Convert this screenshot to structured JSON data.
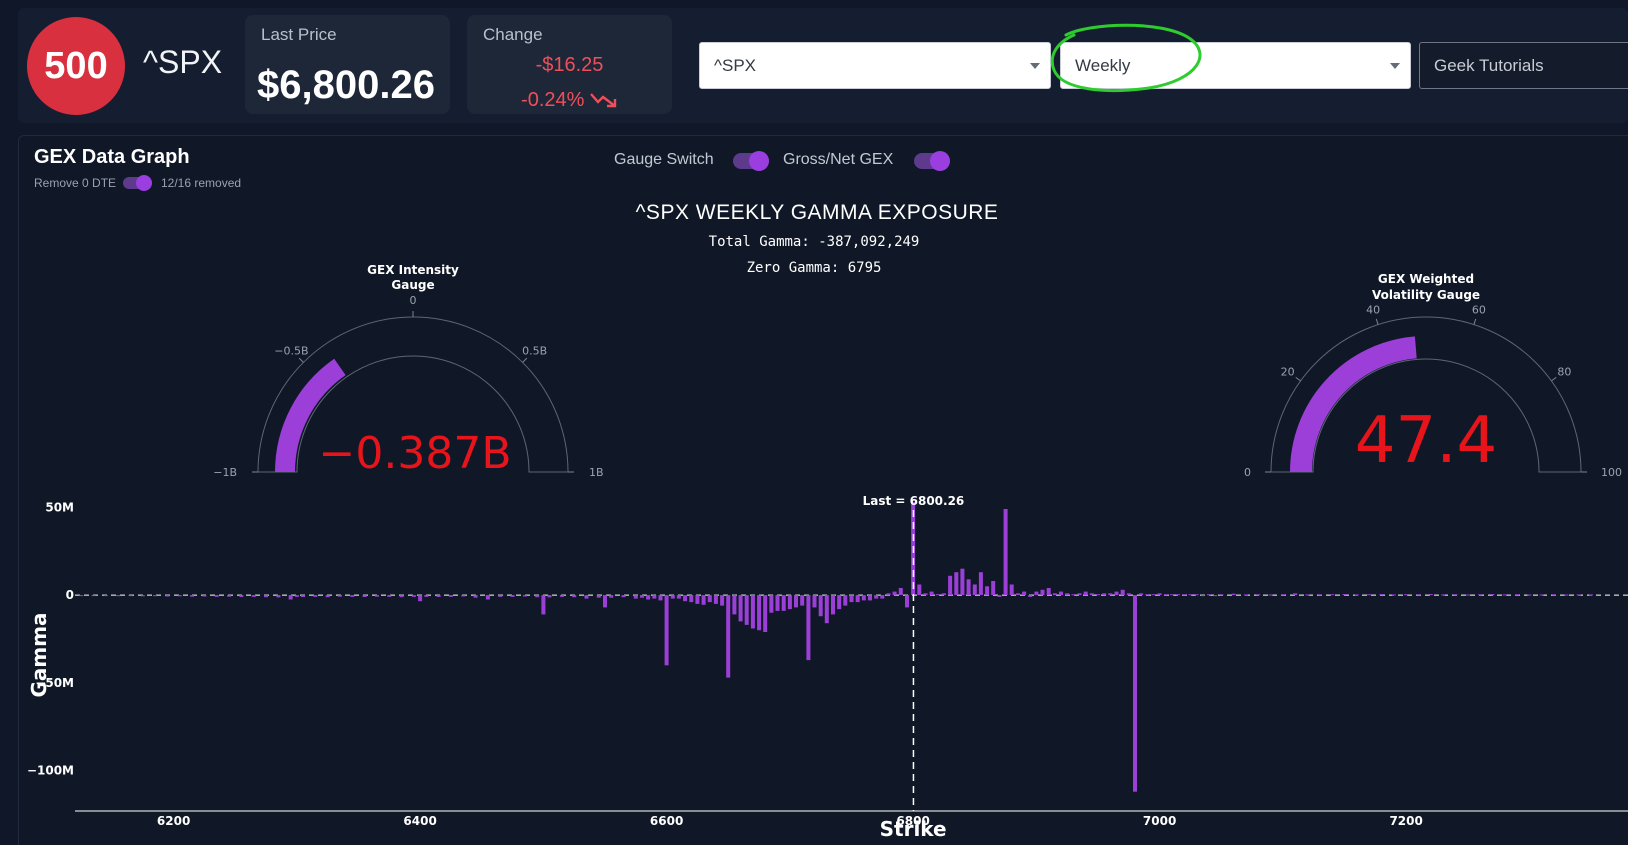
{
  "header": {
    "logo_text": "500",
    "ticker": "^SPX",
    "last_price": {
      "label": "Last Price",
      "value": "$6,800.26"
    },
    "change": {
      "label": "Change",
      "amount": "-$16.25",
      "percent": "-0.24%",
      "direction_icon": "trend-down-icon"
    },
    "symbol_select": {
      "value": "^SPX"
    },
    "expiry_select": {
      "value": "Weekly",
      "highlight_color": "#2ecc2e"
    },
    "tutorials_button": "Geek Tutorials"
  },
  "panel": {
    "title": "GEX Data Graph",
    "remove_dte": {
      "label": "Remove 0 DTE",
      "status": "12/16 removed",
      "on": true
    },
    "gauge_switch": {
      "label": "Gauge Switch",
      "on": true
    },
    "gross_net": {
      "label": "Gross/Net GEX",
      "on": true
    }
  },
  "graph": {
    "title": "^SPX WEEKLY GAMMA EXPOSURE",
    "total_gamma": "Total Gamma: -387,092,249",
    "zero_gamma": "Zero Gamma: 6795"
  },
  "gauges": {
    "intensity": {
      "title_line1": "GEX Intensity",
      "title_line2": "Gauge",
      "value": -0.387,
      "value_text": "−0.387B",
      "range": [
        -1,
        1
      ],
      "ticks": [
        "−1B",
        "−0.5B",
        "0",
        "0.5B",
        "1B"
      ]
    },
    "volatility": {
      "title_line1": "GEX Weighted",
      "title_line2": "Volatility Gauge",
      "value": 47.4,
      "value_text": "47.4",
      "range": [
        0,
        100
      ],
      "ticks": [
        "0",
        "20",
        "40",
        "60",
        "80",
        "100"
      ]
    },
    "bar_color": "#9b3fd8",
    "value_color": "#e8141b"
  },
  "chart_data": {
    "type": "bar",
    "xlabel": "Strike",
    "ylabel": "Gamma",
    "xlim": [
      6120,
      7380
    ],
    "ylim": [
      -123,
      57
    ],
    "x_ticks": [
      6200,
      6400,
      6600,
      6800,
      7000,
      7200
    ],
    "x_tick_labels": [
      "6200",
      "6400",
      "6600",
      "6800",
      "7000",
      "7200"
    ],
    "y_ticks": [
      50,
      0,
      -50,
      -100
    ],
    "y_tick_labels": [
      "50M",
      "0",
      "−50M",
      "−100M"
    ],
    "y_unit": "M",
    "last_marker": {
      "x": 6800.26,
      "label": "Last = 6800.26"
    },
    "color": "#9b3fd8",
    "x": [
      6125,
      6135,
      6145,
      6155,
      6165,
      6175,
      6185,
      6195,
      6205,
      6215,
      6225,
      6235,
      6245,
      6255,
      6265,
      6275,
      6285,
      6295,
      6300,
      6305,
      6315,
      6325,
      6335,
      6345,
      6355,
      6365,
      6375,
      6385,
      6395,
      6400,
      6405,
      6415,
      6425,
      6435,
      6445,
      6455,
      6465,
      6475,
      6485,
      6495,
      6500,
      6505,
      6515,
      6525,
      6535,
      6545,
      6550,
      6555,
      6565,
      6575,
      6580,
      6585,
      6590,
      6595,
      6600,
      6605,
      6610,
      6615,
      6620,
      6625,
      6630,
      6635,
      6640,
      6645,
      6650,
      6655,
      6660,
      6665,
      6670,
      6675,
      6680,
      6685,
      6690,
      6695,
      6700,
      6705,
      6710,
      6715,
      6720,
      6725,
      6730,
      6735,
      6740,
      6745,
      6750,
      6755,
      6760,
      6765,
      6770,
      6775,
      6780,
      6785,
      6790,
      6795,
      6800,
      6805,
      6810,
      6815,
      6820,
      6825,
      6830,
      6835,
      6840,
      6845,
      6850,
      6855,
      6860,
      6865,
      6870,
      6875,
      6880,
      6885,
      6890,
      6895,
      6900,
      6905,
      6910,
      6915,
      6920,
      6925,
      6930,
      6935,
      6940,
      6945,
      6950,
      6955,
      6960,
      6965,
      6970,
      6975,
      6980,
      6985,
      6990,
      6995,
      7000,
      7005,
      7010,
      7015,
      7020,
      7025,
      7030,
      7035,
      7040,
      7045,
      7050,
      7060,
      7070,
      7080,
      7090,
      7100,
      7110,
      7120,
      7130,
      7140,
      7150,
      7160,
      7170,
      7180,
      7190,
      7200,
      7210,
      7220,
      7230,
      7240,
      7250,
      7260,
      7270,
      7280,
      7290,
      7300,
      7310,
      7320,
      7330,
      7340,
      7350,
      7360,
      7370
    ],
    "values": [
      -0.5,
      -0.4,
      -0.5,
      -0.6,
      -0.5,
      -0.7,
      -0.6,
      -0.8,
      -0.7,
      -0.9,
      -0.8,
      -1.0,
      -0.9,
      -1.1,
      -1.0,
      -1.2,
      -1.3,
      -2.5,
      -1.0,
      -1.1,
      -1.0,
      -1.2,
      -0.9,
      -1.0,
      -1.1,
      -0.9,
      -1.0,
      -1.2,
      -1.0,
      -3.5,
      -1.0,
      -1.1,
      -1.0,
      -0.8,
      -1.5,
      -2.5,
      -1.0,
      -1.0,
      -0.8,
      -1.2,
      -11,
      -1.3,
      -1.0,
      -1.2,
      -2.0,
      -1.5,
      -7,
      -1.5,
      -1.2,
      -2.0,
      -1.5,
      -2.5,
      -2.0,
      -3.0,
      -40,
      -2.0,
      -2.0,
      -3.5,
      -4.0,
      -5.0,
      -5.5,
      -4.0,
      -5.0,
      -6.0,
      -47,
      -11,
      -15,
      -17,
      -19,
      -20,
      -21,
      -10,
      -9,
      -9,
      -8,
      -7,
      -6,
      -37,
      -7,
      -12,
      -16,
      -11,
      -8,
      -6,
      -4,
      -4,
      -3,
      -3,
      -2,
      -2,
      1,
      2,
      4,
      -7,
      53,
      6,
      1,
      2,
      0.5,
      1,
      11,
      13,
      15,
      9,
      6,
      13,
      5,
      8,
      -1,
      49,
      6,
      1,
      2,
      -1,
      2,
      3,
      4,
      1,
      2,
      1,
      0.5,
      1,
      2,
      1,
      0.5,
      1,
      1,
      2,
      3,
      1,
      -112,
      1,
      0.5,
      0.5,
      1,
      0.5,
      0.5,
      0.5,
      0.5,
      0.5,
      0.5,
      -0.5,
      0.5,
      -0.4,
      0.5,
      0.8,
      0.4,
      0.5,
      0.3,
      0.5,
      1.0,
      0.4,
      0.5,
      0.5,
      0.6,
      0.4,
      0.5,
      0.6,
      0.4,
      0.5,
      0.5,
      0.6,
      0.4,
      0.5,
      0.3,
      0.5,
      0.6,
      0.4,
      0.5,
      0.3,
      0.4,
      0.5,
      0.3,
      0.4,
      0.4
    ]
  }
}
